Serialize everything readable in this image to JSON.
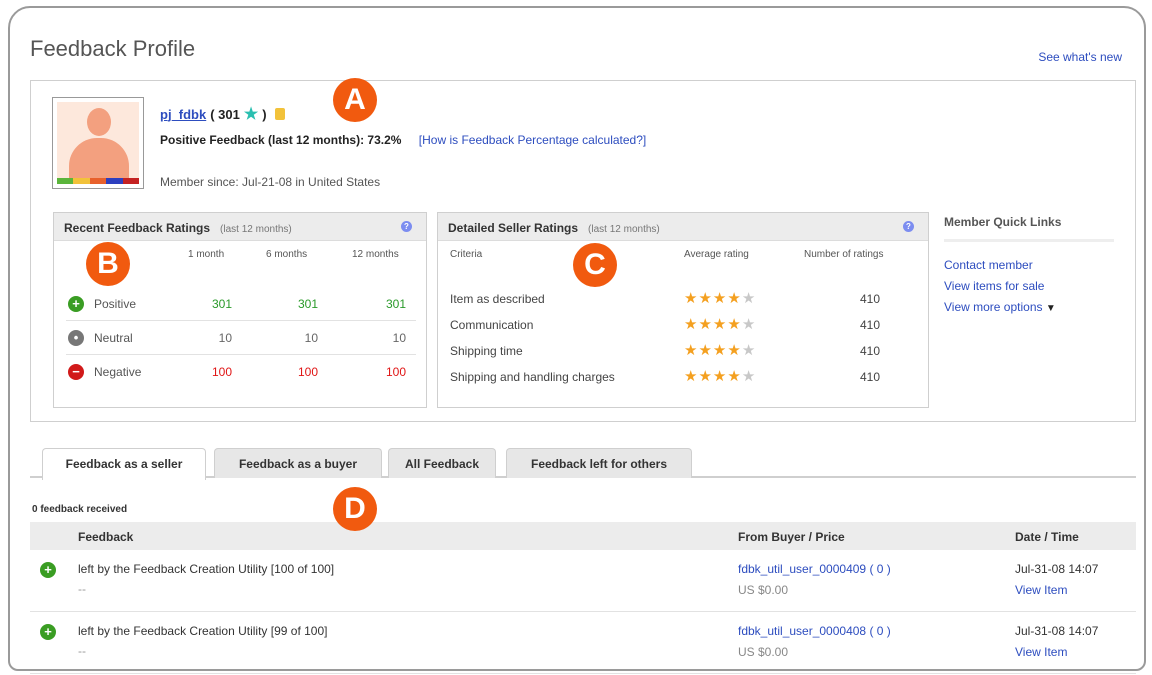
{
  "page": {
    "title": "Feedback Profile",
    "whats_new": "See what's new"
  },
  "markers": {
    "a": "A",
    "b": "B",
    "c": "C",
    "d": "D"
  },
  "profile": {
    "username": "pj_fdbk",
    "score_open": "( 301",
    "score_close": ")",
    "positive_label": "Positive Feedback (last 12 months): 73.2%",
    "calc_link": "[How is Feedback Percentage calculated?]",
    "member_since": "Member since: Jul-21-08 in United States",
    "avatar_strip_colors": [
      "#5bb53b",
      "#f2c23a",
      "#e8612c",
      "#2d3fbf",
      "#c42222"
    ]
  },
  "recent": {
    "title": "Recent Feedback Ratings",
    "subtitle": "(last 12 months)",
    "help": "?",
    "columns": [
      "1 month",
      "6 months",
      "12 months"
    ],
    "rows": [
      {
        "label": "Positive",
        "values": [
          "301",
          "301",
          "301"
        ],
        "color": "#2a9a2a",
        "icon_color": "#3a9d23",
        "icon": "+"
      },
      {
        "label": "Neutral",
        "values": [
          "10",
          "10",
          "10"
        ],
        "color": "#666666",
        "icon_color": "#777777",
        "icon": "•"
      },
      {
        "label": "Negative",
        "values": [
          "100",
          "100",
          "100"
        ],
        "color": "#e01515",
        "icon_color": "#d11a1a",
        "icon": "−"
      }
    ]
  },
  "detailed": {
    "title": "Detailed Seller Ratings",
    "subtitle": "(last 12 months)",
    "help": "?",
    "columns": [
      "Criteria",
      "Average rating",
      "Number of ratings"
    ],
    "rows": [
      {
        "criteria": "Item as described",
        "rating": 4,
        "count": "410"
      },
      {
        "criteria": "Communication",
        "rating": 4,
        "count": "410"
      },
      {
        "criteria": "Shipping time",
        "rating": 4,
        "count": "410"
      },
      {
        "criteria": "Shipping and handling charges",
        "rating": 4,
        "count": "410"
      }
    ]
  },
  "quick_links": {
    "title": "Member Quick Links",
    "items": [
      "Contact member",
      "View items for sale",
      "View more options"
    ]
  },
  "tabs": [
    "Feedback as a seller",
    "Feedback as a buyer",
    "All Feedback",
    "Feedback left for others"
  ],
  "feedback": {
    "received_label": "0 feedback received",
    "headers": [
      "Feedback",
      "From Buyer / Price",
      "Date / Time"
    ],
    "rows": [
      {
        "text": "left by the Feedback Creation Utility [100 of 100]",
        "dash": "--",
        "buyer": "fdbk_util_user_0000409 ( 0 )",
        "price": "US $0.00",
        "date": "Jul-31-08 14:07",
        "view": "View Item"
      },
      {
        "text": "left by the Feedback Creation Utility [99 of 100]",
        "dash": "--",
        "buyer": "fdbk_util_user_0000408 ( 0 )",
        "price": "US $0.00",
        "date": "Jul-31-08 14:07",
        "view": "View Item"
      }
    ]
  }
}
